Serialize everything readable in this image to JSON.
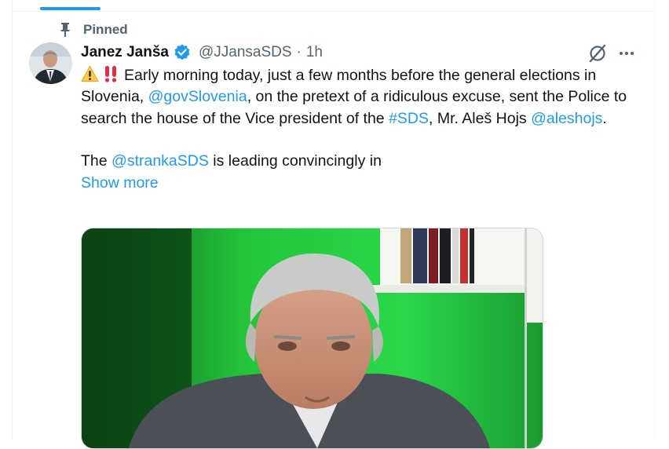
{
  "pinned": {
    "label": "Pinned"
  },
  "tweet": {
    "author_name": "Janez Janša",
    "handle": "@JJansaSDS",
    "separator": "·",
    "time": "1h",
    "text_segments": {
      "s1": "Early morning today, just a few months before the general elections in Slovenia, ",
      "m1": "@govSlovenia",
      "s2": ", on the pretext of a ridiculous excuse, sent the Police to search the house of the Vice president of the ",
      "h1": "#SDS",
      "s3": ", Mr. Aleš Hojs ",
      "m2": "@aleshojs",
      "s4": ".",
      "s5": "The ",
      "m3": "@strankaSDS",
      "s6": " is leading convincingly in"
    },
    "show_more": "Show more"
  },
  "colors": {
    "accent": "#1d9bf0",
    "text": "#0f1419",
    "muted": "#536471",
    "border": "#eff3f4"
  },
  "icons": {
    "pin": "pin-icon",
    "verified": "verified-badge-icon",
    "grok": "grok-icon",
    "more": "more-horizontal-icon"
  }
}
